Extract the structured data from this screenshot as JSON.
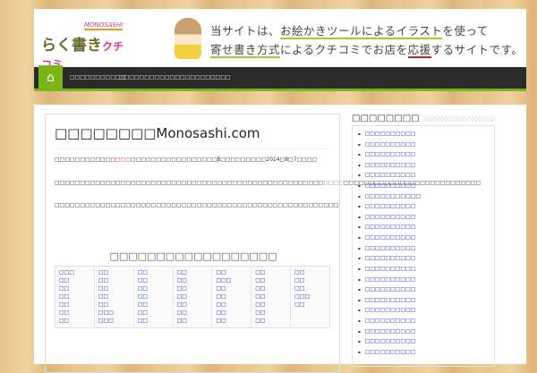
{
  "header": {
    "logo_sub": "MONOSASHI",
    "logo_main": "らく書き",
    "logo_accent": "クチコミ",
    "banner_line1_pre": "当サイトは、",
    "banner_line1_u": "お絵かきツールによるイラスト",
    "banner_line1_post": "を使って",
    "banner_line2_u": "寄せ書き方式",
    "banner_line2_mid": "によるクチコミでお店を",
    "banner_line2_red": "応援",
    "banner_line2_post": "するサイトです。"
  },
  "nav": {
    "home_icon": "home-icon",
    "items": [
      "□□□□□□□□□□□",
      "□□□□□□□□□□□□□□□□□□□□□□"
    ]
  },
  "article": {
    "title": "□□□□□□□□Monosashi.com",
    "p1_a": "□□□□□□□□□□□□",
    "p1_red": "□□□",
    "p1_b": "□□□□□□□□□□□□□□□□□β□□□□□□□□□2014□8□7□□□□",
    "p2_a": "□□□□□□□□□□□□□□□□□□□□□□□□□□□□□□□□□□□□□□□□□□□□□□□□□□□□□",
    "p2_gray": "□□□□",
    "p2_b": "□□□□□□□□□□□□□□□□□□□□□□□□□□□",
    "p3": "□□□□□□□□□□□□□□□□□□□□□□□□□□□□□□□□□□□□□□□□□□□□□□□□□□□□□□□□",
    "table_title": "□□□□□□□□□□□□□□□□□□",
    "table": [
      [
        "□□□",
        "□□",
        "□□",
        "□□",
        "□□",
        "□□",
        "□□"
      ],
      [
        "□□",
        "□□",
        "□□",
        "□□",
        "□□",
        "□□□",
        "□□□"
      ],
      [
        "□□",
        "□□",
        "□□",
        "□□",
        "□□",
        "□□",
        "□□"
      ],
      [
        "□□",
        "□□",
        "□□",
        "□□",
        "□□",
        "□□",
        "□□"
      ],
      [
        "□□",
        "□□□",
        "□□",
        "□□",
        "□□",
        "□□",
        "□□"
      ],
      [
        "□□",
        "□□",
        "□□",
        "□□",
        "□□",
        "□□",
        "□□"
      ],
      [
        "□□",
        "□□",
        "□□",
        "□□□",
        "□□"
      ]
    ]
  },
  "sidebar": {
    "heading": "□□□□□□□□",
    "items": [
      "□□□□□□□□□□",
      "□□□□□□□□□□",
      "□□□□□□□□□□",
      "□□□□□□□□□□",
      "□□□□□□□□□□",
      "□□□□□□□□□□",
      "□□□□□□□□□□□",
      "□□□□□□□□□□",
      "□□□□□□□□□□",
      "□□□□□□□□□□",
      "□□□□□□□□□□",
      "□□□□□□□□□□",
      "□□□□□□□□□□",
      "□□□□□□□□□□",
      "□□□□□□□□□□",
      "□□□□□□□□□□",
      "□□□□□□□□□□",
      "□□□□□□□□□□",
      "□□□□□□□□□□",
      "□□□□□□□□□□",
      "□□□□□□□□□□",
      "□□□□□□□□□□"
    ]
  }
}
